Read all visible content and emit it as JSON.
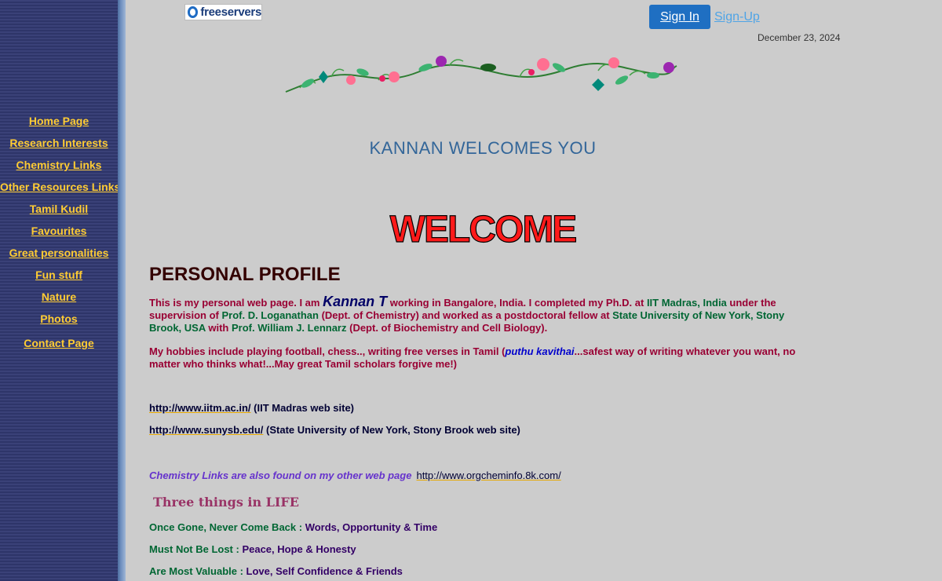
{
  "sidebar": {
    "items": [
      {
        "label": "Home Page"
      },
      {
        "label": "Research Interests"
      },
      {
        "label": "Chemistry Links"
      },
      {
        "label": "Other Resources Links"
      },
      {
        "label": "Tamil Kudil"
      },
      {
        "label": "Favourites"
      },
      {
        "label": "Great personalities"
      },
      {
        "label": "Fun stuff"
      },
      {
        "label": "Nature"
      },
      {
        "label": "Photos"
      },
      {
        "label": "Contact Page"
      }
    ]
  },
  "header": {
    "logo_text": "freeservers",
    "signin_label": "Sign In",
    "signup_label": "Sign-Up",
    "date": "December 23, 2024"
  },
  "welcome": {
    "title": "KANNAN WELCOMES YOU",
    "art_text": "WELCOME"
  },
  "profile": {
    "heading": "PERSONAL PROFILE",
    "p1": {
      "a": "This is my personal web page. I am ",
      "name": "Kannan T",
      "b": " working in Bangalore, India. I completed my Ph.D. at ",
      "iit": "IIT Madras, India",
      "c": " under the supervision of ",
      "prof1": "Prof. D. Loganathan",
      "d": " (Dept. of Chemistry) and worked as a postdoctoral fellow at ",
      "suny": "State University of New York, Stony Brook, USA",
      "e": " with ",
      "prof2": "Prof. William J. Lennarz",
      "f": " (Dept. of Biochemistry and Cell Biology)."
    },
    "p2": {
      "a": "My hobbies include playing football, chess.., writing free verses in Tamil (",
      "puthu": "puthu kavithai",
      "b": "...safest way of writing whatever you want, no matter who thinks what!...May great Tamil scholars forgive me!)"
    }
  },
  "links": [
    {
      "url": "http://www.iitm.ac.in/",
      "desc": " (IIT Madras web site)"
    },
    {
      "url": "http://www.sunysb.edu/",
      "desc": " (State University of New York, Stony Brook  web site)"
    }
  ],
  "chem_links": {
    "lead": "Chemistry Links are also found on my other web page",
    "url": "http://www.orgcheminfo.8k.com/"
  },
  "three_things": {
    "title": "Three things in LIFE",
    "items": [
      {
        "key": "Once Gone, Never Come Back : ",
        "value": "Words, Opportunity & Time"
      },
      {
        "key": "Must Not Be Lost : ",
        "value": "Peace, Hope & Honesty"
      },
      {
        "key": "Are Most Valuable : ",
        "value": "Love, Self Confidence & Friends"
      }
    ]
  }
}
